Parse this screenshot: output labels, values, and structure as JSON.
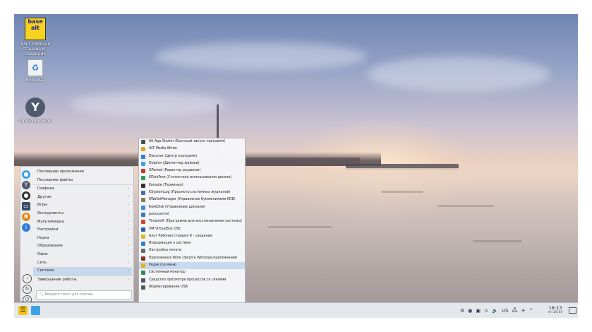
{
  "desktop": {
    "icons": [
      {
        "name": "alt-icon-label",
        "label": "Альт Рабочая станция К - сведения",
        "logo_text": "base alt"
      },
      {
        "name": "trash-label",
        "label": "Корзина"
      },
      {
        "name": "yandex-label",
        "label": "Yandex Browser"
      }
    ]
  },
  "start_menu": {
    "categories": [
      {
        "label": "Последние приложения",
        "sel": false
      },
      {
        "label": "Последние файлы",
        "sel": false
      },
      {
        "label": "Графика",
        "sel": false
      },
      {
        "label": "Другие",
        "sel": false
      },
      {
        "label": "Игры",
        "sel": false
      },
      {
        "label": "Инструменты",
        "sel": false
      },
      {
        "label": "Мультимедиа",
        "sel": false
      },
      {
        "label": "Настройки",
        "sel": false
      },
      {
        "label": "Наука",
        "sel": false
      },
      {
        "label": "Образование",
        "sel": false
      },
      {
        "label": "Офис",
        "sel": false
      },
      {
        "label": "Сеть",
        "sel": false
      },
      {
        "label": "Система",
        "sel": true
      },
      {
        "label": "Завершение работы",
        "sel": false
      }
    ],
    "search_placeholder": "Введите текст для поиска...",
    "arrow": "›"
  },
  "submenu": {
    "items": [
      {
        "label": "Alt App Starter (Быстрый запуск программ)",
        "color": "#4a4f5a"
      },
      {
        "label": "ALT Media Writer",
        "color": "#e0a21d"
      },
      {
        "label": "Discover (Центр программ)",
        "color": "#2f7fd7"
      },
      {
        "label": "Dolphin (Диспетчер файлов)",
        "color": "#3aa3e3"
      },
      {
        "label": "GParted (Редактор разделов)",
        "color": "#c23b2e"
      },
      {
        "label": "KDiskFree (Статистика использования дисков)",
        "color": "#2e9e52"
      },
      {
        "label": "Konsole (Терминал)",
        "color": "#333333"
      },
      {
        "label": "KSystemLog (Просмотр системных журналов)",
        "color": "#4d6ea8"
      },
      {
        "label": "KWalletManager (Управление бумажниками KDE)",
        "color": "#8a7a5a"
      },
      {
        "label": "KwikDisk (Управление дисками)",
        "color": "#3b8fd9"
      },
      {
        "label": "pavucontrol",
        "color": "#3c77c6"
      },
      {
        "label": "Timeshift (Программа для восстановления системы)",
        "color": "#d9452b"
      },
      {
        "label": "VM VirtualBox OSE",
        "color": "#2a5fa5"
      },
      {
        "label": "Альт Рабочая станция К - сведения",
        "color": "#e5b81f"
      },
      {
        "label": "Информация о системе",
        "color": "#2f7fd7"
      },
      {
        "label": "Настройка печати",
        "color": "#6a6a6a"
      },
      {
        "label": "Приложения Wine (Запуск Windows-приложений)",
        "color": "#8c2b2b"
      },
      {
        "label": "Редактор меню",
        "color": "#e6b51a",
        "sel": true
      },
      {
        "label": "Системный монитор",
        "color": "#2e8c4e"
      },
      {
        "label": "Средство просмотра процессов со связями",
        "color": "#4b5563"
      },
      {
        "label": "Форматирование USB",
        "color": "#555555"
      }
    ]
  },
  "taskbar": {
    "tray": {
      "lang": "US",
      "volume": "🔈",
      "network": "🖧",
      "arrow": "^"
    },
    "clock": {
      "time": "16:13",
      "date": "пн 28.04"
    }
  },
  "colors": {
    "accent": "#c7d8ed",
    "taskbar_bg": "#e6e9ed"
  }
}
